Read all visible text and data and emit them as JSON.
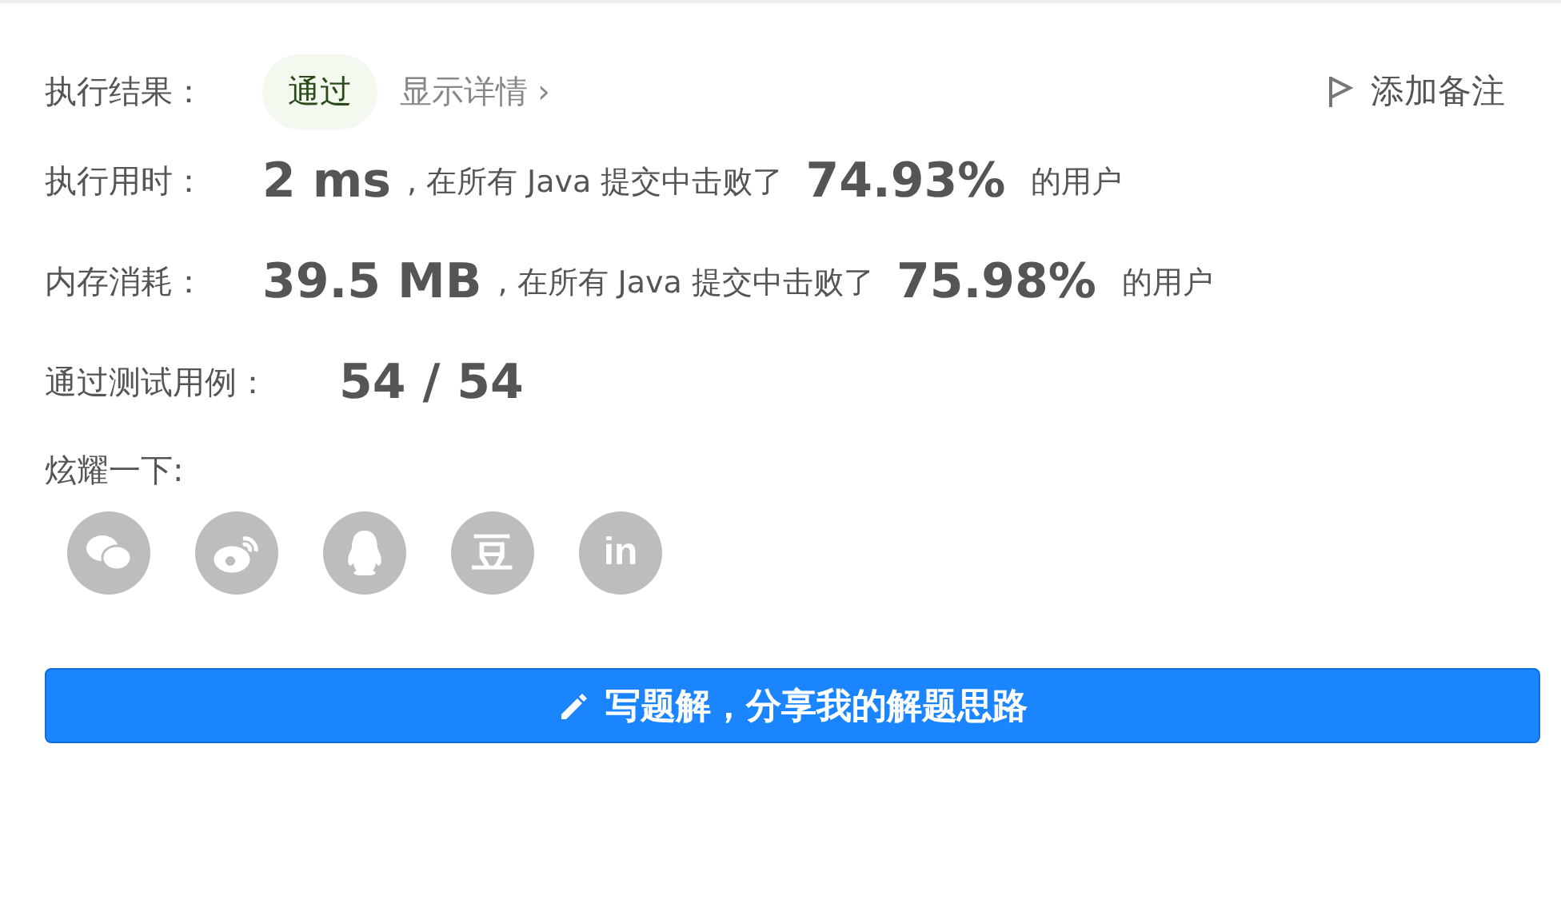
{
  "result": {
    "label": "执行结果：",
    "status": "通过",
    "details_link": "显示详情",
    "details_chevron": "›",
    "note_button": "添加备注"
  },
  "stats": [
    {
      "label": "执行用时：",
      "value": "2 ms",
      "text_before": ", 在所有 Java 提交中击败了",
      "percent": "74.93%",
      "text_after": "的用户"
    },
    {
      "label": "内存消耗：",
      "value": "39.5 MB",
      "text_before": ", 在所有 Java 提交中击败了",
      "percent": "75.98%",
      "text_after": "的用户"
    }
  ],
  "tests": {
    "label": "通过测试用例：",
    "value": "54 / 54"
  },
  "share": {
    "label": "炫耀一下:",
    "buttons": [
      {
        "kind": "wechat"
      },
      {
        "kind": "weibo"
      },
      {
        "kind": "qq"
      },
      {
        "kind": "douban",
        "glyph": "豆"
      },
      {
        "kind": "linkedin",
        "glyph": "in"
      }
    ]
  },
  "write_button": "写题解，分享我的解题思路"
}
